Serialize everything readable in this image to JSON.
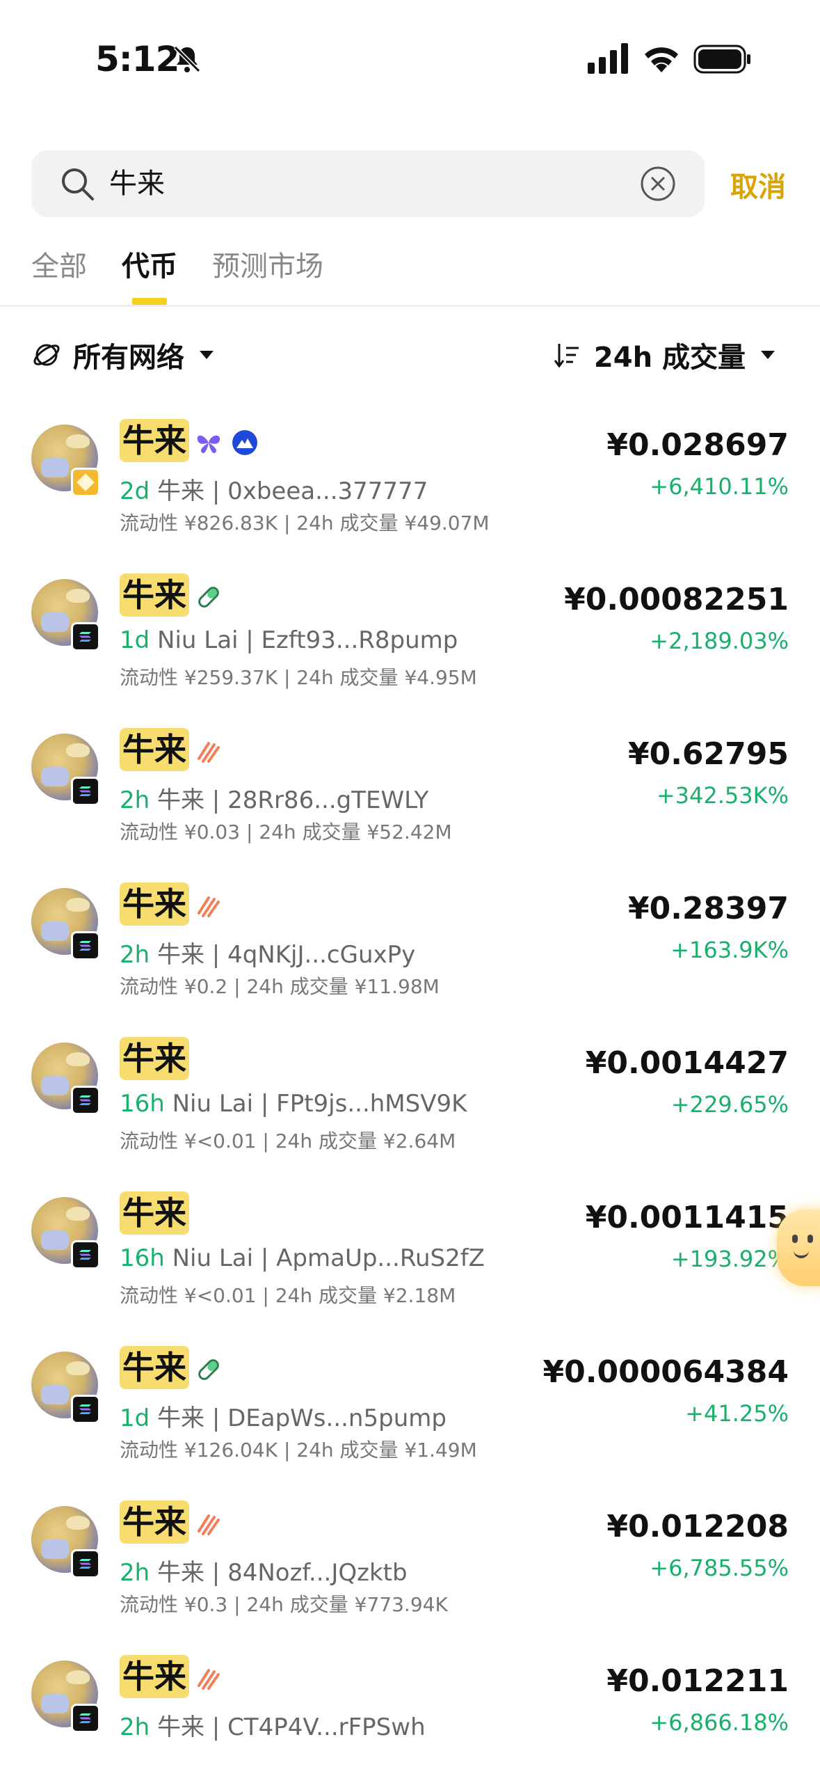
{
  "status_bar": {
    "time": "5:12"
  },
  "search": {
    "query": "牛来",
    "cancel_label": "取消"
  },
  "tabs": [
    {
      "label": "全部",
      "active": false
    },
    {
      "label": "代币",
      "active": true
    },
    {
      "label": "预测市场",
      "active": false
    }
  ],
  "filters": {
    "network_label": "所有网络",
    "sort_label": "24h 成交量"
  },
  "tokens": [
    {
      "name": "牛来",
      "age": "2d",
      "meta": "牛来 | 0xbeea...377777",
      "stats": "流动性 ¥826.83K | 24h 成交量 ¥49.07M",
      "price": "¥0.028697",
      "change": "+6,410.11%",
      "chain": "bnb",
      "tags": [
        "butterfly-icon",
        "mountain-badge-icon"
      ]
    },
    {
      "name": "牛来",
      "age": "1d",
      "meta": "Niu Lai | Ezft93...R8pump",
      "stats": "流动性 ¥259.37K | 24h 成交量 ¥4.95M",
      "price": "¥0.00082251",
      "change": "+2,189.03%",
      "chain": "sol",
      "tags": [
        "pill-icon"
      ]
    },
    {
      "name": "牛来",
      "age": "2h",
      "meta": "牛来 | 28Rr86...gTEWLY",
      "stats": "流动性 ¥0.03 | 24h 成交量 ¥52.42M",
      "price": "¥0.62795",
      "change": "+342.53K%",
      "chain": "sol",
      "tags": [
        "stripes-icon"
      ]
    },
    {
      "name": "牛来",
      "age": "2h",
      "meta": "牛来 | 4qNKjJ...cGuxPy",
      "stats": "流动性 ¥0.2 | 24h 成交量 ¥11.98M",
      "price": "¥0.28397",
      "change": "+163.9K%",
      "chain": "sol",
      "tags": [
        "stripes-icon"
      ]
    },
    {
      "name": "牛来",
      "age": "16h",
      "meta": "Niu Lai | FPt9js...hMSV9K",
      "stats": "流动性 ¥<0.01 | 24h 成交量 ¥2.64M",
      "price": "¥0.0014427",
      "change": "+229.65%",
      "chain": "sol",
      "tags": []
    },
    {
      "name": "牛来",
      "age": "16h",
      "meta": "Niu Lai | ApmaUp...RuS2fZ",
      "stats": "流动性 ¥<0.01 | 24h 成交量 ¥2.18M",
      "price": "¥0.0011415",
      "change": "+193.92%",
      "chain": "sol",
      "tags": []
    },
    {
      "name": "牛来",
      "age": "1d",
      "meta": "牛来 | DEapWs...n5pump",
      "stats": "流动性 ¥126.04K | 24h 成交量 ¥1.49M",
      "price": "¥0.000064384",
      "change": "+41.25%",
      "chain": "sol",
      "tags": [
        "pill-icon"
      ]
    },
    {
      "name": "牛来",
      "age": "2h",
      "meta": "牛来 | 84Nozf...JQzktb",
      "stats": "流动性 ¥0.3 | 24h 成交量 ¥773.94K",
      "price": "¥0.012208",
      "change": "+6,785.55%",
      "chain": "sol",
      "tags": [
        "stripes-icon"
      ]
    },
    {
      "name": "牛来",
      "age": "2h",
      "meta": "牛来 | CT4P4V...rFPSwh",
      "stats": "",
      "price": "¥0.012211",
      "change": "+6,866.18%",
      "chain": "sol",
      "tags": [
        "stripes-icon"
      ]
    }
  ],
  "colors": {
    "accent": "#f5cf1e",
    "positive": "#19b06b",
    "cancel": "#d9a400",
    "name_highlight": "#f7dc6f"
  }
}
